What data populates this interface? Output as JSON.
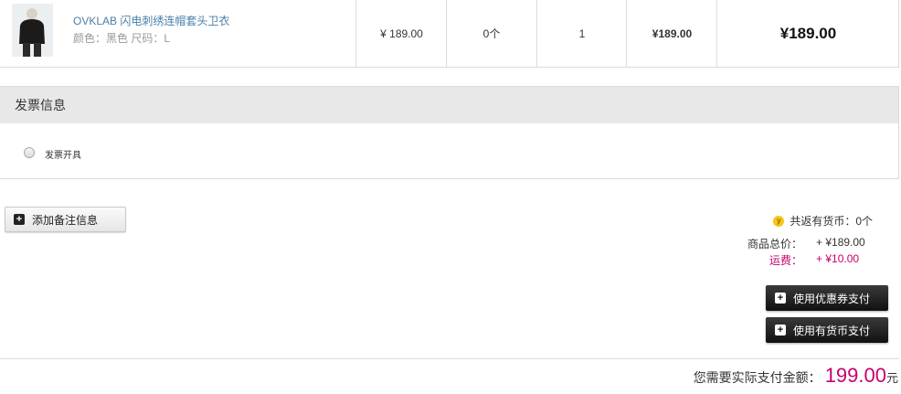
{
  "product": {
    "name": "OVKLAB 闪电刺绣连帽套头卫衣",
    "spec": "颜色：黑色 尺码：L",
    "unit_price": "¥ 189.00",
    "coins": "0个",
    "quantity": "1",
    "subtotal": "¥189.00",
    "total": "¥189.00"
  },
  "invoice": {
    "title": "发票信息",
    "option_label": "发票开具"
  },
  "actions": {
    "add_note": "添加备注信息",
    "use_coupon": "使用优惠券支付",
    "use_coins": "使用有货币支付"
  },
  "summary": {
    "coin_icon": "y",
    "coins_back": "共返有货币：0个",
    "goods_label": "商品总价：",
    "goods_value": "+ ¥189.00",
    "shipping_label": "运费：",
    "shipping_value": "+ ¥10.00",
    "pay_label": "您需要实际支付金额：",
    "pay_value": "199.00",
    "pay_unit": "元"
  },
  "colors": {
    "accent": "#c8006e",
    "link": "#4a7fa7",
    "shipping": "#c8006e"
  }
}
